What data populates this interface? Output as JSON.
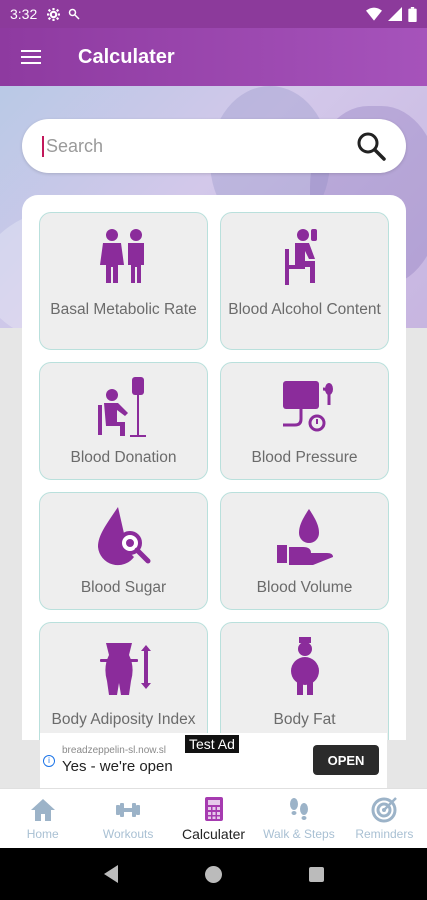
{
  "status": {
    "time": "3:32"
  },
  "app": {
    "title": "Calculater"
  },
  "search": {
    "placeholder": "Search"
  },
  "calculators": [
    {
      "label": "Basal Metabolic Rate",
      "icon": "couple-icon"
    },
    {
      "label": "Blood Alcohol Content",
      "icon": "drinking-person-icon"
    },
    {
      "label": "Blood Donation",
      "icon": "blood-donation-icon"
    },
    {
      "label": "Blood Pressure",
      "icon": "blood-pressure-monitor-icon"
    },
    {
      "label": "Blood Sugar",
      "icon": "blood-drop-magnifier-icon"
    },
    {
      "label": "Blood Volume",
      "icon": "drop-on-hand-icon"
    },
    {
      "label": "Body Adiposity Index",
      "icon": "waist-measure-icon"
    },
    {
      "label": "Body Fat",
      "icon": "body-fat-person-icon"
    }
  ],
  "ad": {
    "badge": "Test Ad",
    "url": "breadzeppelin-sl.now.sl",
    "headline": "Yes - we're open",
    "cta": "OPEN"
  },
  "bottom_nav": [
    {
      "label": "Home",
      "icon": "home-icon",
      "active": false
    },
    {
      "label": "Workouts",
      "icon": "dumbbell-icon",
      "active": false
    },
    {
      "label": "Calculater",
      "icon": "calculator-icon",
      "active": true
    },
    {
      "label": "Walk & Steps",
      "icon": "footsteps-icon",
      "active": false
    },
    {
      "label": "Reminders",
      "icon": "target-icon",
      "active": false
    }
  ],
  "colors": {
    "primary": "#8e3aa0",
    "icon": "#8b2c9b",
    "tile_border": "#b9e0dc"
  }
}
